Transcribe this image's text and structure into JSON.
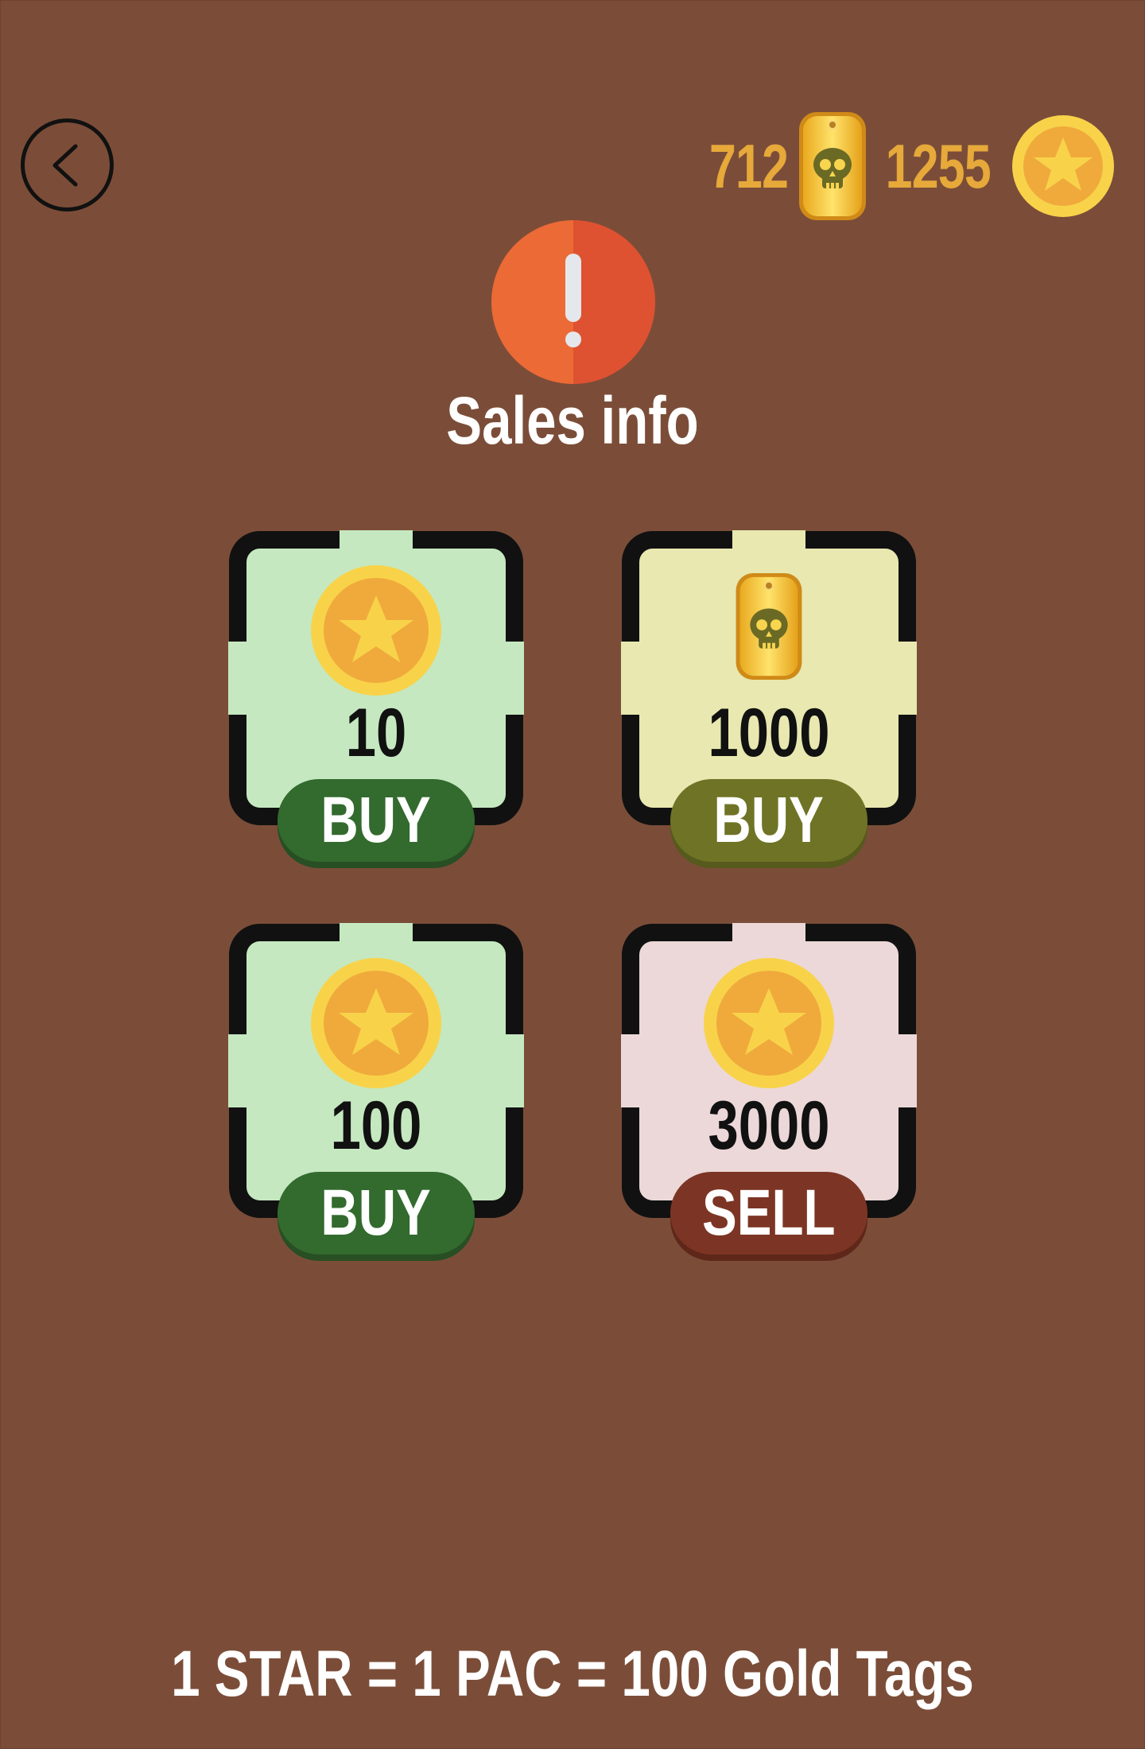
{
  "header": {
    "gold_tags": "712",
    "stars": "1255",
    "back_icon": "chevron-left-icon"
  },
  "title": "Sales info",
  "colors": {
    "background": "#7b4d38",
    "currency_text": "#e6a93a",
    "green_card": "#c5e8c0",
    "yellow_card": "#e8e8b0",
    "pink_card": "#ecd8d8"
  },
  "cards": [
    {
      "icon": "star-coin-icon",
      "amount": "10",
      "action": "BUY"
    },
    {
      "icon": "gold-tag-icon",
      "amount": "1000",
      "action": "BUY"
    },
    {
      "icon": "star-coin-icon",
      "amount": "100",
      "action": "BUY"
    },
    {
      "icon": "star-coin-icon",
      "amount": "3000",
      "action": "SELL"
    }
  ],
  "footer": "1 STAR = 1 PAC = 100 Gold Tags"
}
